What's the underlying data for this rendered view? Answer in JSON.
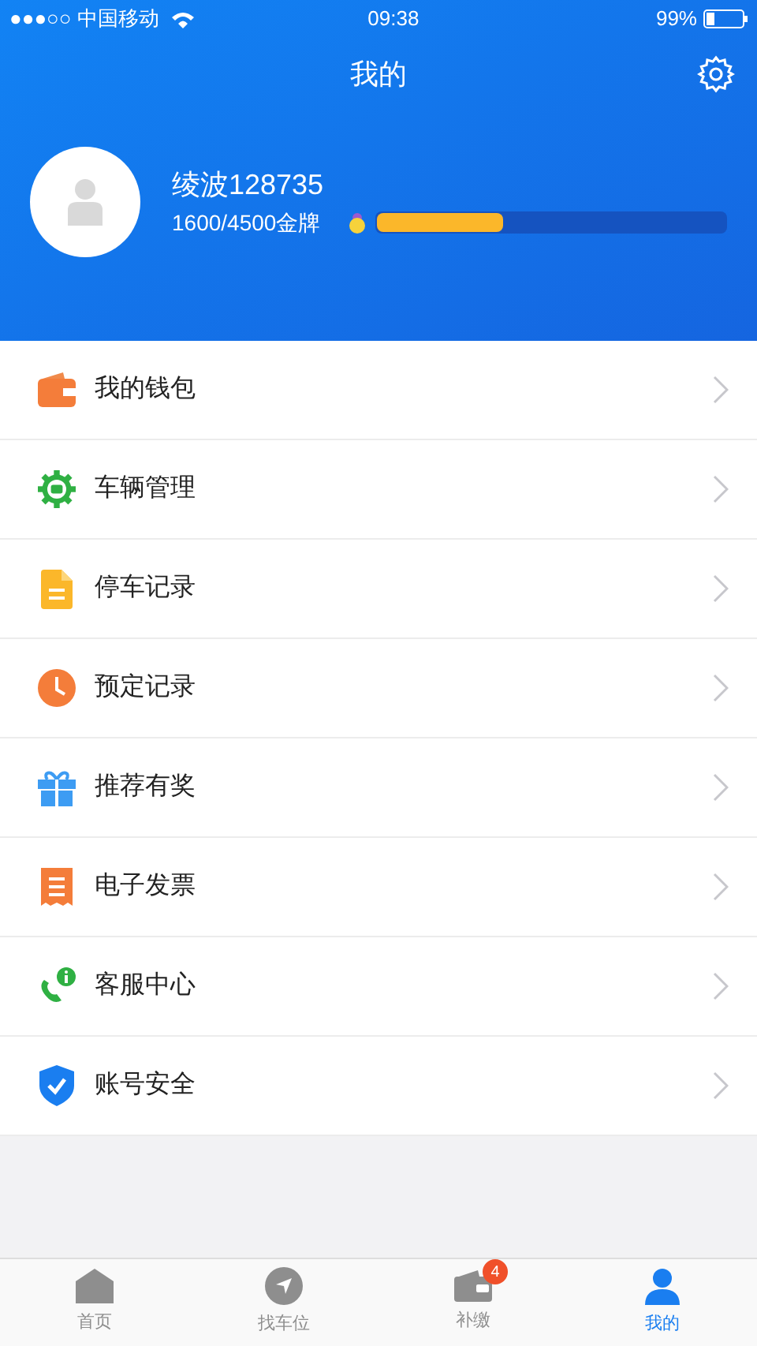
{
  "status_bar": {
    "carrier": "●●●○○ 中国移动",
    "time": "09:38",
    "battery": "99%"
  },
  "nav": {
    "title": "我的"
  },
  "profile": {
    "name": "绫波128735",
    "points": "1600/4500金牌",
    "level": 0.36
  },
  "menu": [
    {
      "label": "我的钱包"
    },
    {
      "label": "车辆管理"
    },
    {
      "label": "停车记录"
    },
    {
      "label": "预定记录"
    },
    {
      "label": "推荐有奖"
    },
    {
      "label": "电子发票"
    },
    {
      "label": "客服中心"
    },
    {
      "label": "账号安全"
    }
  ],
  "tabs": [
    {
      "label": "首页",
      "selected": false
    },
    {
      "label": "找车位",
      "selected": false
    },
    {
      "label": "补缴",
      "selected": false,
      "badge": "4"
    },
    {
      "label": "我的",
      "selected": true
    }
  ]
}
